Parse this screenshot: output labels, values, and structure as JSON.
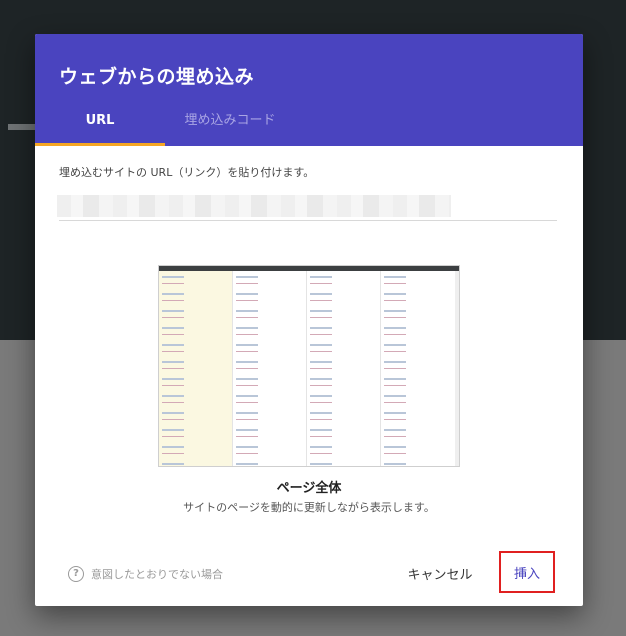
{
  "dialog": {
    "title": "ウェブからの埋め込み",
    "tabs": [
      {
        "label": "URL",
        "active": true
      },
      {
        "label": "埋め込みコード",
        "active": false
      }
    ],
    "instruction": "埋め込むサイトの URL（リンク）を貼り付けます。",
    "url_input": {
      "value": "",
      "placeholder": ""
    },
    "preview": {
      "mode_title": "ページ全体",
      "mode_description": "サイトのページを動的に更新しながら表示します。"
    },
    "footer": {
      "help_label": "意図したとおりでない場合",
      "cancel_label": "キャンセル",
      "insert_label": "挿入"
    }
  },
  "icons": {
    "help": "help-circle-icon"
  },
  "colors": {
    "header": "#4a44bf",
    "tab_indicator": "#f5a623",
    "insert_text": "#4a44bf",
    "highlight_border": "#e02020"
  }
}
